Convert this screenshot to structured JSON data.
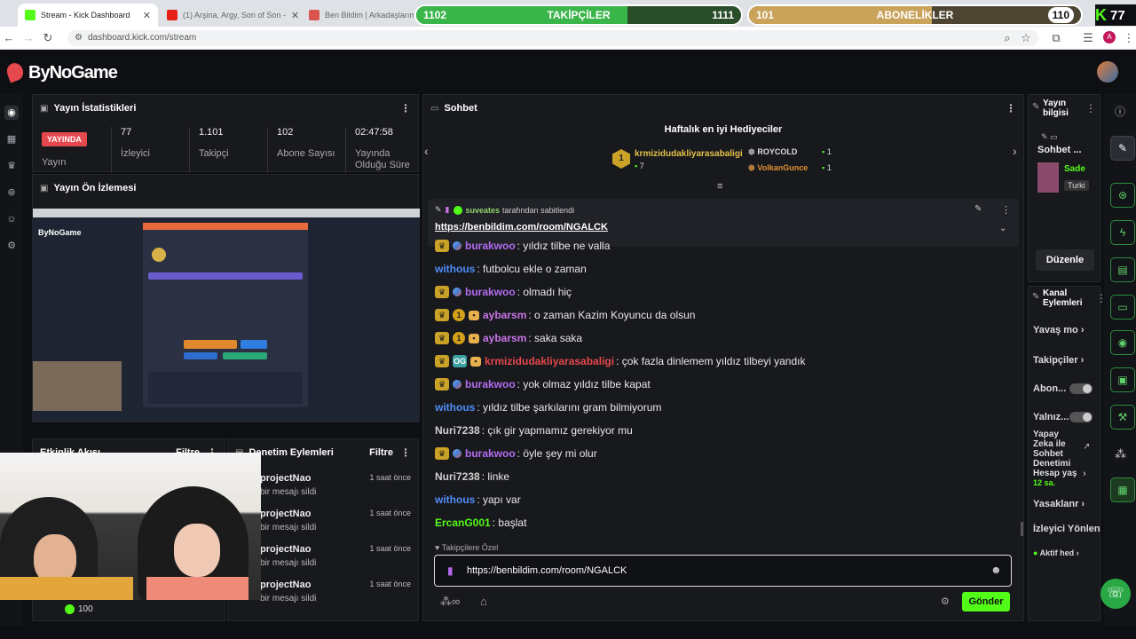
{
  "browser": {
    "tabs": [
      {
        "title": "Stream - Kick Dashboard"
      },
      {
        "title": "(1) Arşina, Argy, Son of Son -"
      },
      {
        "title": "Ben Bildim | Arkadaşlarınla G"
      }
    ],
    "url": "dashboard.kick.com/stream",
    "profile_initial": "A"
  },
  "goals": {
    "followers": {
      "label": "TAKİPÇİLER",
      "start": "1102",
      "end": "1111",
      "progress": 0.65
    },
    "subscribers": {
      "label": "ABONELİKLER",
      "start": "101",
      "end": "110",
      "progress": 0.55
    },
    "kick_count": "77"
  },
  "brand": {
    "logo_text": "ByNoGame"
  },
  "stats": {
    "title": "Yayın İstatistikleri",
    "live_badge": "YAYINDA",
    "live_label": "Yayın",
    "viewers": {
      "value": "77",
      "label": "İzleyici"
    },
    "followers": {
      "value": "1.101",
      "label": "Takipçi"
    },
    "subs": {
      "value": "102",
      "label": "Abone Sayısı"
    },
    "uptime": {
      "value": "02:47:58",
      "label": "Yayında Olduğu Süre"
    }
  },
  "preview": {
    "title": "Yayın Ön İzlemesi",
    "logo": "ByNoGame"
  },
  "activity": {
    "title": "Etkinlik Akışı",
    "filter": "Filtre"
  },
  "moderation": {
    "title": "Denetim Eylemleri",
    "filter": "Filtre",
    "items": [
      {
        "user": "projectNao",
        "action": "bir mesajı sildi",
        "time": "1 saat önce"
      },
      {
        "user": "projectNao",
        "action": "bir mesajı sildi",
        "time": "1 saat önce"
      },
      {
        "user": "projectNao",
        "action": "bir mesajı sildi",
        "time": "1 saat önce"
      },
      {
        "user": "projectNao",
        "action": "bir mesajı sildi",
        "time": "1 saat önce"
      }
    ]
  },
  "bottom_count": "100",
  "chat": {
    "title": "Sohbet",
    "gifters_title": "Haftalık en iyi Hediyeciler",
    "gifters": [
      {
        "rank": "1",
        "name": "krmizidudakliyarasabaligi",
        "count": "7"
      },
      {
        "name": "ROYCOLD",
        "count": "1"
      },
      {
        "name": "VolkanGunce",
        "count": "1"
      }
    ],
    "pinned": {
      "by_user": "suveates",
      "by_text": "tarafından sabitlendi",
      "link": "https://benbildim.com/room/NGALCK"
    },
    "messages": [
      {
        "user": "burakwoo",
        "color": "#b36cf0",
        "text": "yıldız tilbe ne valla",
        "badges": "crown-globe"
      },
      {
        "user": "withous",
        "color": "#4f8ef7",
        "text": "futbolcu ekle o zaman",
        "badges": ""
      },
      {
        "user": "burakwoo",
        "color": "#b36cf0",
        "text": "olmadı hiç",
        "badges": "crown-globe"
      },
      {
        "user": "aybarsm",
        "color": "#c975e8",
        "text": "o zaman Kazim Koyuncu da olsun",
        "badges": "crown-sub-gift"
      },
      {
        "user": "aybarsm",
        "color": "#c975e8",
        "text": "saka saka",
        "badges": "crown-sub-gift"
      },
      {
        "user": "krmizidudakliyarasabaligi",
        "color": "#e5484d",
        "text": "çok fazla dinlemem yıldız tilbeyi yandık",
        "badges": "crown-og-gift"
      },
      {
        "user": "burakwoo",
        "color": "#b36cf0",
        "text": "yok olmaz yıldız tilbe kapat",
        "badges": "crown-globe"
      },
      {
        "user": "withous",
        "color": "#4f8ef7",
        "text": "yıldız tilbe şarkılarını gram bilmiyorum",
        "badges": ""
      },
      {
        "user": "Nuri7238",
        "color": "#cfcfcf",
        "text": "çık gir yapmamız gerekiyor mu",
        "badges": ""
      },
      {
        "user": "burakwoo",
        "color": "#b36cf0",
        "text": "öyle şey mi olur",
        "badges": "crown-globe"
      },
      {
        "user": "Nuri7238",
        "color": "#cfcfcf",
        "text": "linke",
        "badges": ""
      },
      {
        "user": "withous",
        "color": "#4f8ef7",
        "text": "yapı var",
        "badges": ""
      },
      {
        "user": "ErcanG001",
        "color": "#53fc18",
        "text": "başlat",
        "badges": ""
      }
    ],
    "followers_only": "Takipçilere Özel",
    "input_value": "https://benbildim.com/room/NGALCK",
    "send_label": "Gönder"
  },
  "stream_info": {
    "title": "Yayın bilgisi",
    "chat_label": "Sohbet ...",
    "title_snippet": "Sade",
    "lang": "Turki",
    "edit_label": "Düzenle"
  },
  "channel_actions": {
    "title": "Kanal Eylemleri",
    "items": [
      {
        "label": "Yavaş mo"
      },
      {
        "label": "Takipçiler"
      },
      {
        "label": "Abon..."
      },
      {
        "label": "Yalnız..."
      },
      {
        "label": "Yapay Zeka ile Sohbet Denetimi Hesap yaş",
        "sub": "12 sa."
      },
      {
        "label": "Yasaklanr"
      },
      {
        "label": "İzleyici Yönlen"
      },
      {
        "label": "Aktif hed"
      }
    ]
  },
  "colors": {
    "accent": "#53fc18",
    "live": "#e5484d",
    "panel": "#18191d"
  }
}
